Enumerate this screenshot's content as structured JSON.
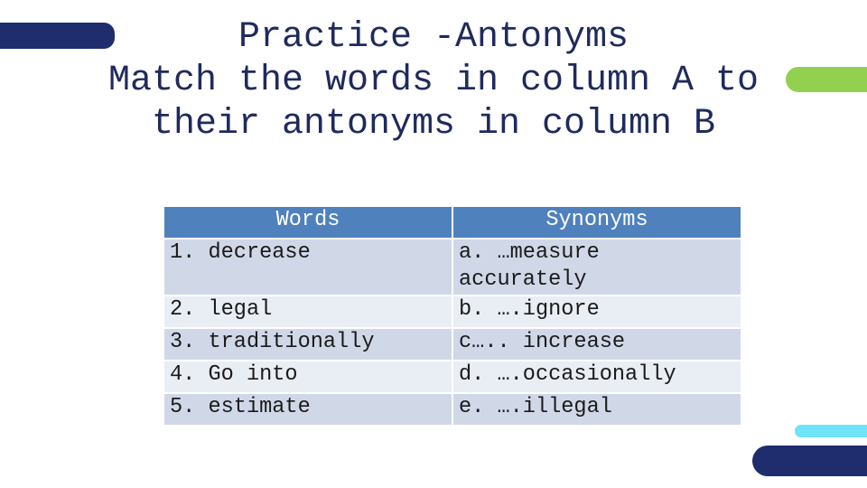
{
  "title": "Practice -Antonyms\nMatch the words in column A to\ntheir antonyms in column B",
  "table": {
    "headers": [
      "Words",
      "Synonyms"
    ],
    "rows": [
      [
        "1. decrease",
        "a. …measure accurately"
      ],
      [
        "2. legal",
        "b. ….ignore"
      ],
      [
        "3. traditionally",
        "c….. increase"
      ],
      [
        "4. Go into",
        "d. ….occasionally"
      ],
      [
        "5. estimate",
        "e. ….illegal"
      ]
    ]
  },
  "colors": {
    "navy": "#1f2d6e",
    "green": "#92d050",
    "cyan": "#6fe3f7",
    "header": "#4f81bd"
  }
}
